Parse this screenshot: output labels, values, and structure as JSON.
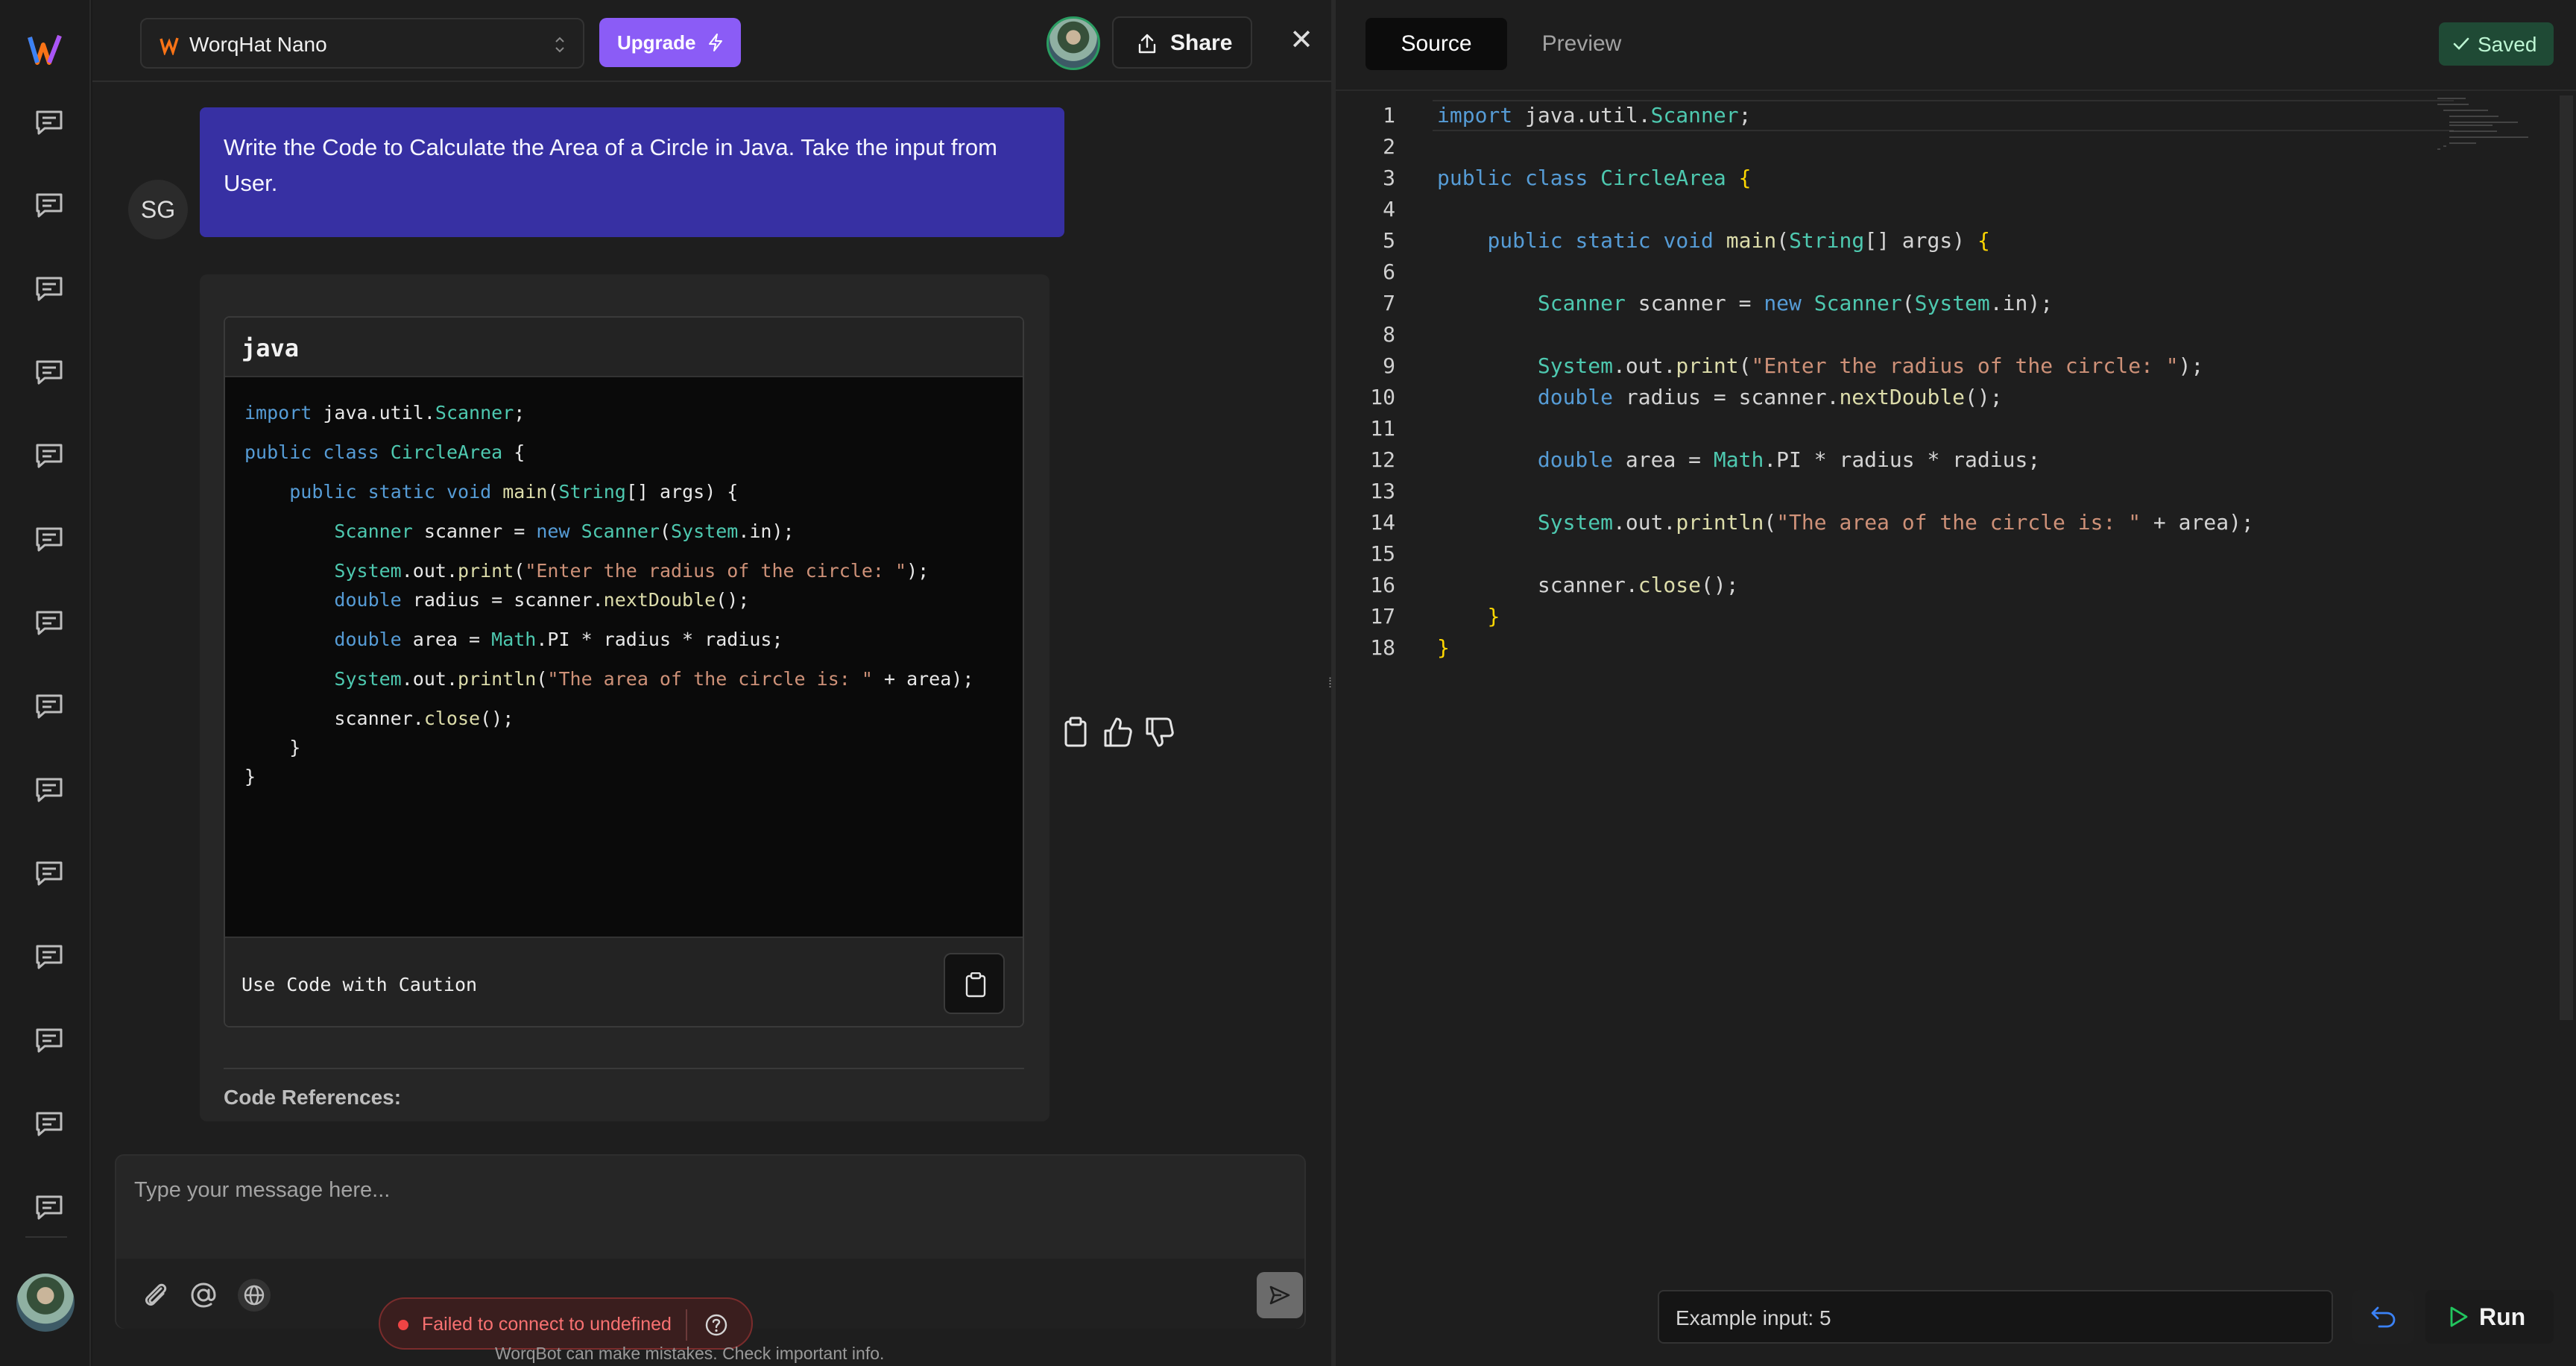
{
  "colors": {
    "accent": "#8b5cf6",
    "user_bubble": "#3730a3",
    "saved": "#1f4a35",
    "error": "#ef4444"
  },
  "header": {
    "model_name": "WorqHat Nano",
    "upgrade_label": "Upgrade",
    "share_label": "Share",
    "close_label": "✕"
  },
  "chat": {
    "user_initials": "SG",
    "user_message": "Write the Code to Calculate the Area of a Circle in Java. Take the input from User.",
    "code_language": "java",
    "code_lines": [
      "import java.util.Scanner;",
      "",
      "public class CircleArea {",
      "",
      "    public static void main(String[] args) {",
      "",
      "        Scanner scanner = new Scanner(System.in);",
      "",
      "        System.out.print(\"Enter the radius of the circle: \");",
      "        double radius = scanner.nextDouble();",
      "",
      "        double area = Math.PI * radius * radius;",
      "",
      "        System.out.println(\"The area of the circle is: \" + area);",
      "",
      "        scanner.close();",
      "    }",
      "}"
    ],
    "caution_label": "Use Code with Caution",
    "references_label": "Code References:",
    "composer_placeholder": "Type your message here...",
    "toast_message": "Failed to connect to undefined",
    "disclaimer": "WorqBot can make mistakes. Check important info."
  },
  "editor": {
    "tab_source": "Source",
    "tab_preview": "Preview",
    "saved_label": "Saved",
    "line_numbers": [
      "1",
      "2",
      "3",
      "4",
      "5",
      "6",
      "7",
      "8",
      "9",
      "10",
      "11",
      "12",
      "13",
      "14",
      "15",
      "16",
      "17",
      "18"
    ],
    "example_input": "Example input: 5",
    "run_label": "Run"
  },
  "icons": [
    "logo-icon",
    "chat-bubble-icon",
    "chevrons-updown-icon",
    "bolt-icon",
    "share-icon",
    "close-icon",
    "clipboard-icon",
    "thumbs-up-icon",
    "thumbs-down-icon",
    "paperclip-icon",
    "at-icon",
    "globe-icon",
    "send-icon",
    "help-icon",
    "check-icon",
    "undo-icon",
    "play-icon",
    "grip-icon"
  ]
}
